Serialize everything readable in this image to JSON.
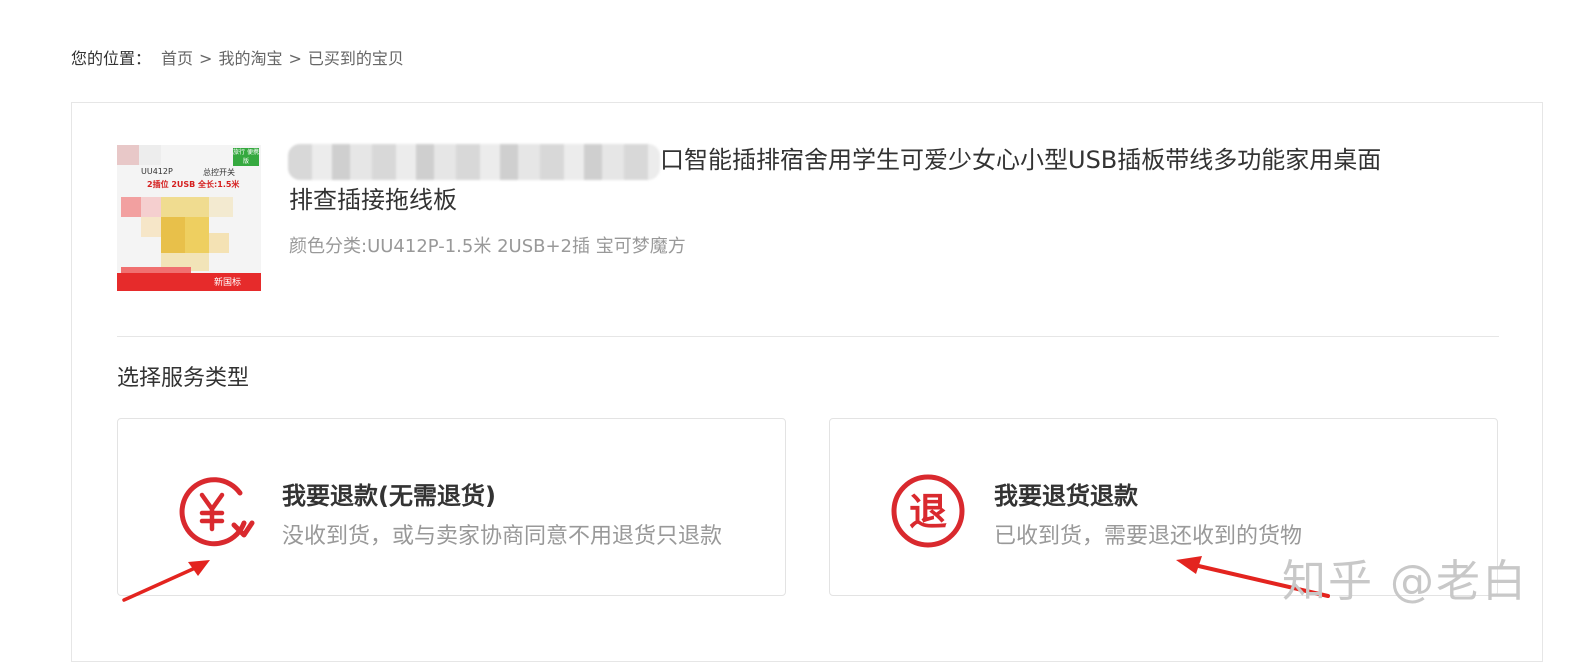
{
  "breadcrumb": {
    "prefix": "您的位置：",
    "items": [
      "首页",
      "我的淘宝",
      "已买到的宝贝"
    ],
    "separator": ">"
  },
  "product": {
    "thumbnail": {
      "model": "UU412P",
      "switch_label": "总控开关",
      "badge": "旅行\n便携版",
      "spec": "2插位 2USB 全长:1.5米",
      "footer": "新国标"
    },
    "title_line1": "口智能插排宿舍用学生可爱少女心小型USB插板带线多功能家用桌面",
    "title_line2": "排查插接拖线板",
    "sku": "颜色分类:UU412P-1.5米 2USB+2插 宝可梦魔方"
  },
  "service": {
    "section_title": "选择服务类型",
    "options": [
      {
        "icon": "refund-yen-icon",
        "heading": "我要退款(无需退货)",
        "description": "没收到货，或与卖家协商同意不用退货只退款"
      },
      {
        "icon": "return-tui-icon",
        "heading": "我要退货退款",
        "description": "已收到货，需要退还收到的货物"
      }
    ]
  },
  "watermark": "知乎 @老白",
  "colors": {
    "accent_red": "#d9292e",
    "annotation_red": "#e3241f",
    "text_main": "#333333",
    "text_muted": "#999999",
    "border": "#e6e6e6"
  }
}
